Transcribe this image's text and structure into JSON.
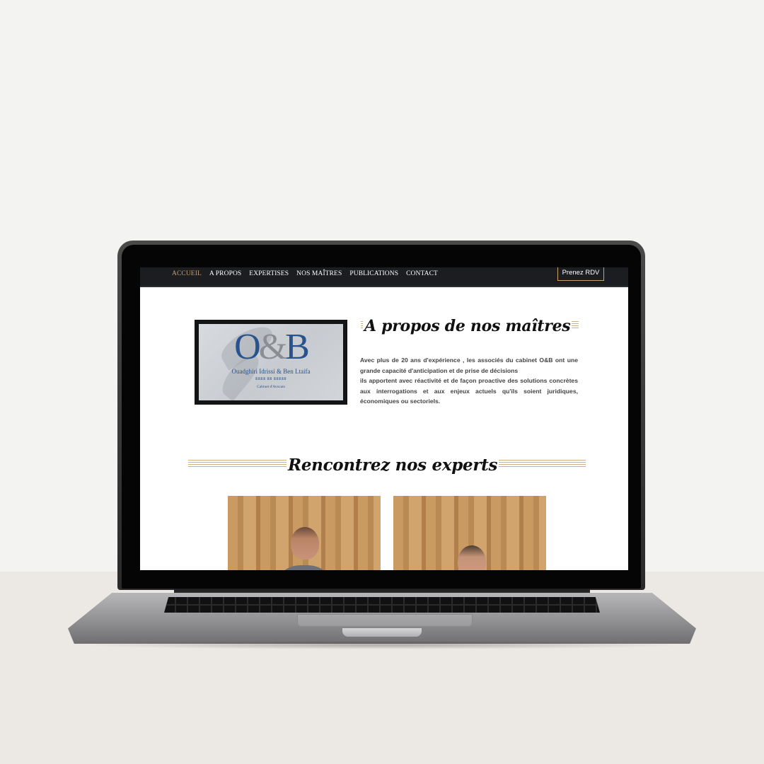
{
  "nav": {
    "links": [
      "ACCUEIL",
      "A PROPOS",
      "EXPERTISES",
      "NOS MAÎTRES",
      "PUBLICATIONS",
      "CONTACT"
    ],
    "active": "ACCUEIL",
    "cta": "Prenez RDV"
  },
  "logo": {
    "letters_left": "O",
    "ampersand": "&",
    "letters_right": "B",
    "name": "Ouadghiri Idrissi & Ben Ltaifa",
    "subtitle": "ⵓⵓⵓⵓ ⵓⵓ ⵓⵓⵓⵓⵓ",
    "tagline": "Cabinet d'Avocats"
  },
  "about": {
    "heading": "A propos de nos maîtres",
    "line1": "Avec plus de 20 ans d'expérience , les associés du cabinet O&B ont une grande capacité d'anticipation et de prise de décisions",
    "line2": "ils apportent avec réactivité et de façon proactive des solutions concrètes aux interrogations et aux enjeux actuels qu'ils soient juridiques, économiques ou sectoriels."
  },
  "experts": {
    "heading": "Rencontrez nos experts"
  },
  "colors": {
    "accent_gold": "#c9a26a",
    "nav_bg": "#1b1d20",
    "logo_blue": "#29538c"
  }
}
